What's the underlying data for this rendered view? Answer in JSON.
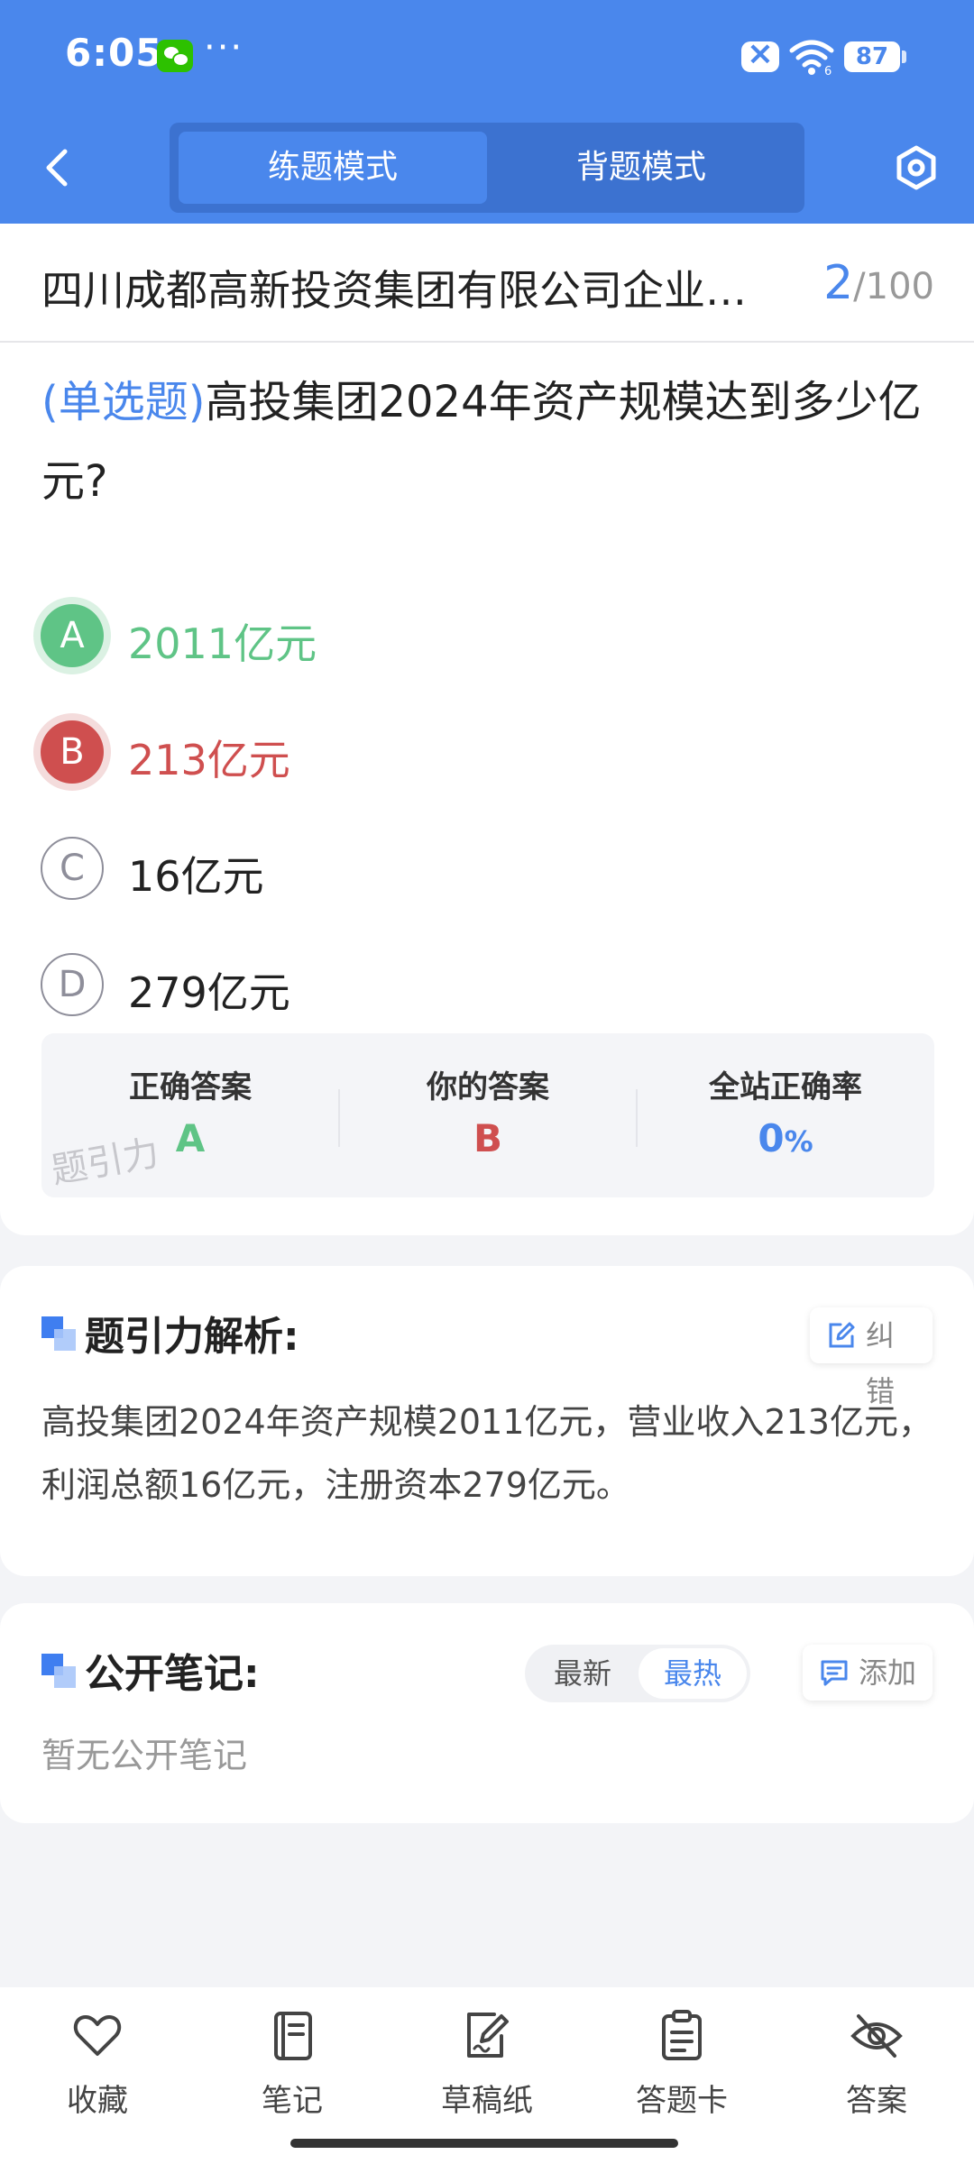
{
  "status_bar": {
    "time": "6:05",
    "dots": "···",
    "battery": "87"
  },
  "header": {
    "mode_tabs": [
      {
        "label": "练题模式",
        "active": true
      },
      {
        "label": "背题模式",
        "active": false
      }
    ]
  },
  "exam": {
    "title": "四川成都高新投资集团有限公司企业…",
    "current": "2",
    "total": "/100"
  },
  "question": {
    "type": "(单选题)",
    "text": "高投集团2024年资产规模达到多少亿元?"
  },
  "options": [
    {
      "letter": "A",
      "text": "2011亿元",
      "state": "correct"
    },
    {
      "letter": "B",
      "text": "213亿元",
      "state": "wrong"
    },
    {
      "letter": "C",
      "text": "16亿元",
      "state": "normal"
    },
    {
      "letter": "D",
      "text": "279亿元",
      "state": "normal"
    }
  ],
  "answer_summary": {
    "correct_label": "正确答案",
    "correct_value": "A",
    "yours_label": "你的答案",
    "yours_value": "B",
    "rate_label": "全站正确率",
    "rate_value": "0",
    "rate_unit": "%",
    "watermark": "题引力"
  },
  "analysis": {
    "title": "题引力解析:",
    "report_label": "纠错",
    "text": "高投集团2024年资产规模2011亿元，营业收入213亿元，利润总额16亿元，注册资本279亿元。"
  },
  "notes": {
    "title": "公开笔记:",
    "sort_newest": "最新",
    "sort_hottest": "最热",
    "add_label": "添加",
    "empty_text": "暂无公开笔记"
  },
  "bottom_nav": [
    {
      "label": "收藏",
      "icon": "heart-icon"
    },
    {
      "label": "笔记",
      "icon": "notebook-icon"
    },
    {
      "label": "草稿纸",
      "icon": "draft-paper-icon"
    },
    {
      "label": "答题卡",
      "icon": "answer-sheet-icon"
    },
    {
      "label": "答案",
      "icon": "eye-off-icon"
    }
  ],
  "colors": {
    "primary": "#4a87ec",
    "correct": "#5fc486",
    "wrong": "#cf4f4f"
  }
}
